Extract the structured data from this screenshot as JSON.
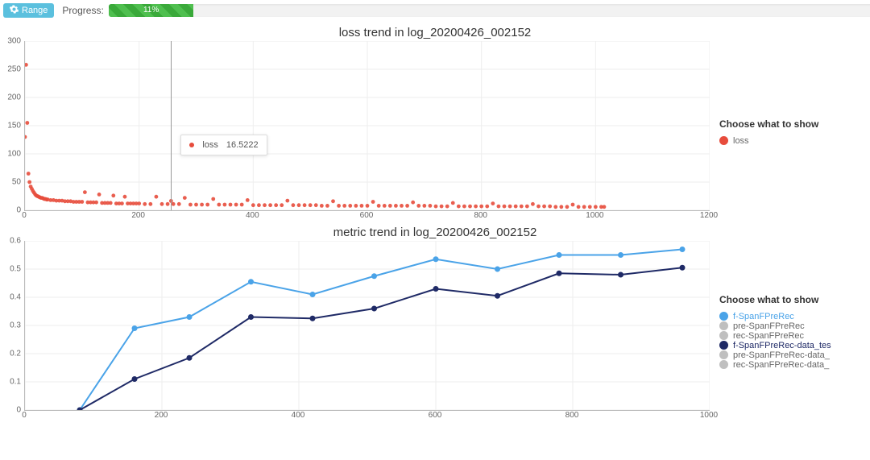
{
  "topbar": {
    "range_label": "Range",
    "progress_label": "Progress:",
    "progress_pct": 11,
    "progress_text": "11%"
  },
  "charts": {
    "loss": {
      "title": "loss trend in log_20200426_002152",
      "legend_title": "Choose what to show",
      "legend": [
        {
          "label": "loss",
          "color": "#e74c3c",
          "active": true
        }
      ],
      "tooltip": {
        "series": "loss",
        "value": "16.5222",
        "color": "#e74c3c",
        "x": 256
      },
      "xticks": [
        0,
        200,
        400,
        600,
        800,
        1000,
        1200
      ],
      "yticks": [
        0,
        50,
        100,
        150,
        200,
        250,
        300
      ]
    },
    "metric": {
      "title": "metric trend in log_20200426_002152",
      "legend_title": "Choose what to show",
      "legend": [
        {
          "label": "f-SpanFPreRec",
          "color": "#4aa3e8",
          "active": true
        },
        {
          "label": "pre-SpanFPreRec",
          "color": "#bfbfbf",
          "active": false
        },
        {
          "label": "rec-SpanFPreRec",
          "color": "#bfbfbf",
          "active": false
        },
        {
          "label": "f-SpanFPreRec-data_tes",
          "color": "#1f2a66",
          "active": true
        },
        {
          "label": "pre-SpanFPreRec-data_",
          "color": "#bfbfbf",
          "active": false
        },
        {
          "label": "rec-SpanFPreRec-data_",
          "color": "#bfbfbf",
          "active": false
        }
      ],
      "xticks": [
        0,
        200,
        400,
        600,
        800,
        1000
      ],
      "yticks": [
        0,
        0.1,
        0.2,
        0.3,
        0.4,
        0.5,
        0.6
      ]
    }
  },
  "chart_data": [
    {
      "type": "scatter",
      "title": "loss trend in log_20200426_002152",
      "xlabel": "",
      "ylabel": "",
      "xlim": [
        0,
        1200
      ],
      "ylim": [
        0,
        300
      ],
      "series": [
        {
          "name": "loss",
          "color": "#e74c3c",
          "x": [
            0,
            2,
            4,
            6,
            8,
            10,
            12,
            14,
            16,
            18,
            20,
            22,
            24,
            26,
            28,
            30,
            32,
            34,
            36,
            38,
            40,
            45,
            50,
            55,
            60,
            65,
            70,
            75,
            80,
            85,
            90,
            95,
            100,
            105,
            110,
            115,
            120,
            125,
            130,
            135,
            140,
            145,
            150,
            155,
            160,
            165,
            170,
            175,
            180,
            185,
            190,
            195,
            200,
            210,
            220,
            230,
            240,
            250,
            256,
            260,
            270,
            280,
            290,
            300,
            310,
            320,
            330,
            340,
            350,
            360,
            370,
            380,
            390,
            400,
            410,
            420,
            430,
            440,
            450,
            460,
            470,
            480,
            490,
            500,
            510,
            520,
            530,
            540,
            550,
            560,
            570,
            580,
            590,
            600,
            610,
            620,
            630,
            640,
            650,
            660,
            670,
            680,
            690,
            700,
            710,
            720,
            730,
            740,
            750,
            760,
            770,
            780,
            790,
            800,
            810,
            820,
            830,
            840,
            850,
            860,
            870,
            880,
            890,
            900,
            910,
            920,
            930,
            940,
            950,
            960,
            970,
            980,
            990,
            1000,
            1010,
            1015
          ],
          "y": [
            130,
            258,
            155,
            65,
            50,
            42,
            38,
            34,
            31,
            28,
            26,
            25,
            24,
            23,
            22,
            22,
            21,
            20,
            20,
            19,
            19,
            18,
            18,
            17,
            17,
            17,
            16,
            16,
            16,
            15,
            15,
            15,
            15,
            32,
            14,
            14,
            14,
            14,
            28,
            13,
            13,
            13,
            13,
            26,
            12,
            12,
            12,
            24,
            12,
            12,
            12,
            12,
            12,
            11,
            11,
            24,
            11,
            11,
            16.5,
            11,
            11,
            22,
            10,
            10,
            10,
            10,
            20,
            10,
            10,
            10,
            10,
            10,
            18,
            9,
            9,
            9,
            9,
            9,
            9,
            17,
            9,
            9,
            9,
            9,
            9,
            8,
            8,
            16,
            8,
            8,
            8,
            8,
            8,
            8,
            15,
            8,
            8,
            8,
            8,
            8,
            8,
            14,
            8,
            8,
            8,
            7,
            7,
            7,
            13,
            7,
            7,
            7,
            7,
            7,
            7,
            12,
            7,
            7,
            7,
            7,
            7,
            7,
            11,
            7,
            7,
            7,
            6,
            6,
            6,
            10,
            6,
            6,
            6,
            6,
            6,
            6
          ]
        }
      ]
    },
    {
      "type": "line",
      "title": "metric trend in log_20200426_002152",
      "xlabel": "",
      "ylabel": "",
      "xlim": [
        0,
        1000
      ],
      "ylim": [
        0,
        0.6
      ],
      "categories": [
        80,
        160,
        240,
        330,
        420,
        510,
        600,
        690,
        780,
        870,
        960
      ],
      "series": [
        {
          "name": "f-SpanFPreRec",
          "color": "#4aa3e8",
          "values": [
            0.0,
            0.29,
            0.33,
            0.455,
            0.41,
            0.475,
            0.535,
            0.5,
            0.55,
            0.55,
            0.57
          ]
        },
        {
          "name": "f-SpanFPreRec-data_test",
          "color": "#1f2a66",
          "values": [
            0.0,
            0.11,
            0.185,
            0.33,
            0.325,
            0.36,
            0.43,
            0.405,
            0.485,
            0.48,
            0.505
          ]
        }
      ]
    }
  ],
  "colors": {
    "loss": "#e74c3c",
    "series_a": "#4aa3e8",
    "series_b": "#1f2a66",
    "inactive": "#bfbfbf",
    "accent": "#5bc0de"
  }
}
